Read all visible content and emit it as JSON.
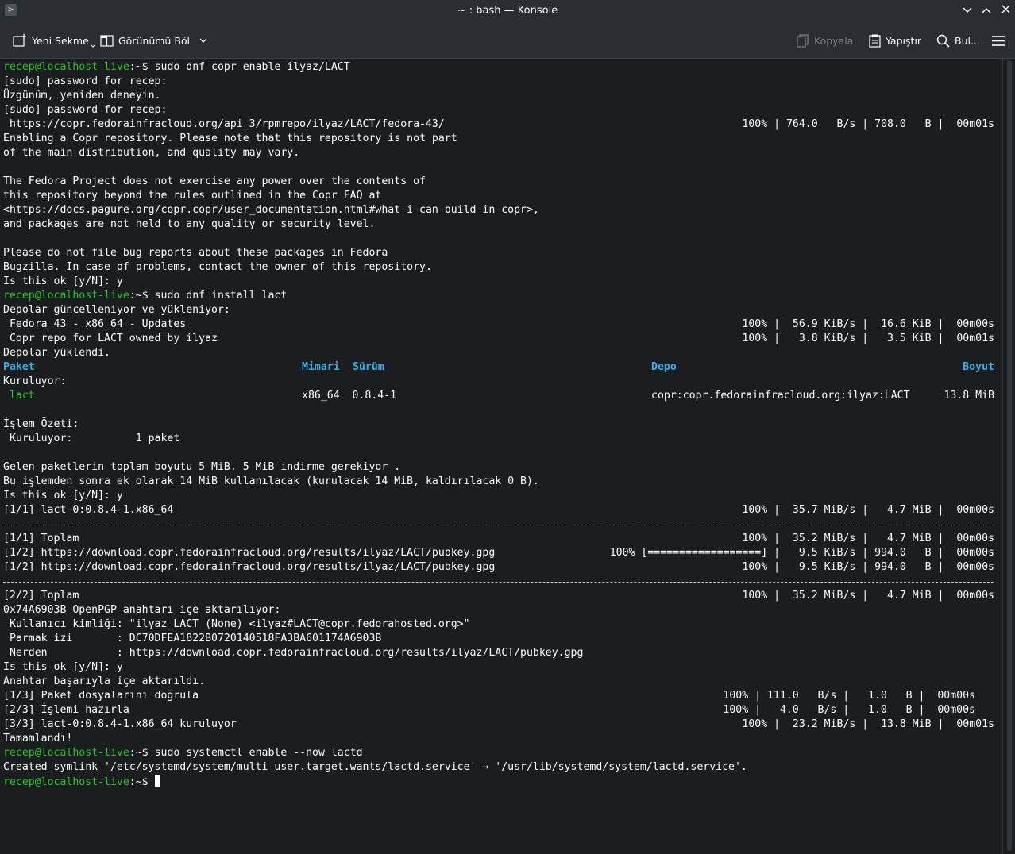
{
  "window": {
    "title": "~ : bash — Konsole",
    "menu_glyph": ">"
  },
  "toolbar": {
    "new_tab": "Yeni Sekme",
    "split_view": "Görünümü Böl",
    "copy": "Kopyala",
    "paste": "Yapıştır",
    "find": "Bul..."
  },
  "terminal": {
    "prompt_user": "recep@localhost-live",
    "prompt_sep": ":~$ ",
    "lines": [
      "[sudo] password for recep:",
      "Üzgünüm, yeniden deneyin.",
      "[sudo] password for recep:",
      " https://copr.fedorainfracloud.org/api_3/rpmrepo/ilyaz/LACT/fedora-43/",
      "Enabling a Copr repository. Please note that this repository is not part",
      "of the main distribution, and quality may vary.",
      "The Fedora Project does not exercise any power over the contents of",
      "this repository beyond the rules outlined in the Copr FAQ at",
      "<https://docs.pagure.org/copr.copr/user_documentation.html#what-i-can-build-in-copr>,",
      "and packages are not held to any quality or security level.",
      "Please do not file bug reports about these packages in Fedora",
      "Bugzilla. In case of problems, contact the owner of this repository.",
      "Is this ok [y/N]: y",
      "Depolar güncelleniyor ve yükleniyor:",
      " Fedora 43 - x86_64 - Updates",
      " Copr repo for LACT owned by ilyaz",
      "Depolar yüklendi.",
      "Kuruluyor:",
      "x86_64  0.8.4-1",
      "copr:copr.fedorainfracloud.org:ilyaz:LACT",
      "İşlem Özeti:",
      " Kuruluyor:          1 paket",
      "Gelen paketlerin toplam boyutu 5 MiB. 5 MiB indirme gerekiyor .",
      "Bu işlemden sonra ek olarak 14 MiB kullanılacak (kurulacak 14 MiB, kaldırılacak 0 B).",
      "Is this ok [y/N]: y",
      "[1/1] lact-0:0.8.4-1.x86_64",
      "[1/1] Toplam",
      "[1/2] https://download.copr.fedorainfracloud.org/results/ilyaz/LACT/pubkey.gpg",
      "[1/2] https://download.copr.fedorainfracloud.org/results/ilyaz/LACT/pubkey.gpg",
      "[2/2] Toplam",
      "0x74A6903B OpenPGP anahtarı içe aktarılıyor:",
      " Kullanıcı kimliği: \"ilyaz_LACT (None) <ilyaz#LACT@copr.fedorahosted.org>\"",
      " Parmak izi       : DC70DFEA1822B0720140518FA3BA601174A6903B",
      " Nerden           : https://download.copr.fedorainfracloud.org/results/ilyaz/LACT/pubkey.gpg",
      "Is this ok [y/N]: y",
      "Anahtar başarıyla içe aktarıldı.",
      "[1/3] Paket dosyalarını doğrula",
      "[2/3] İşlemi hazırla",
      "[3/3] lact-0:0.8.4-1.x86_64 kuruluyor",
      "Tamamlandı!",
      "Created symlink '/etc/systemd/system/multi-user.target.wants/lactd.service' → '/usr/lib/systemd/system/lactd.service'."
    ],
    "commands": {
      "c1": "sudo dnf copr enable ilyaz/LACT",
      "c2": "sudo dnf install lact",
      "c3": "sudo systemctl enable --now lactd"
    },
    "package_name": " lact",
    "table_headers": {
      "paket": "Paket",
      "mimari": "Mimari",
      "surum": "Sürüm",
      "depo": "Depo",
      "boyut": "Boyut"
    },
    "sizes": {
      "lact_size": "13.8 MiB"
    },
    "stats": {
      "s1": "100% | 764.0   B/s | 708.0   B |  00m01s",
      "s2": "100% |  56.9 KiB/s |  16.6 KiB |  00m00s",
      "s3": "100% |   3.8 KiB/s |   3.5 KiB |  00m01s",
      "s4": "100% |  35.7 MiB/s |   4.7 MiB |  00m00s",
      "s5": "100% |  35.2 MiB/s |   4.7 MiB |  00m00s",
      "s6": "100% [==================] |   9.5 KiB/s | 994.0   B |  00m00s",
      "s7": "100% |   9.5 KiB/s | 994.0   B |  00m00s",
      "s8": "100% |  35.2 MiB/s |   4.7 MiB |  00m00s",
      "s9": "100% | 111.0   B/s |   1.0   B |  00m00s",
      "s10": "100% |   4.0   B/s |   1.0   B |  00m00s",
      "s11": "100% |  23.2 MiB/s |  13.8 MiB |  00m01s"
    }
  }
}
